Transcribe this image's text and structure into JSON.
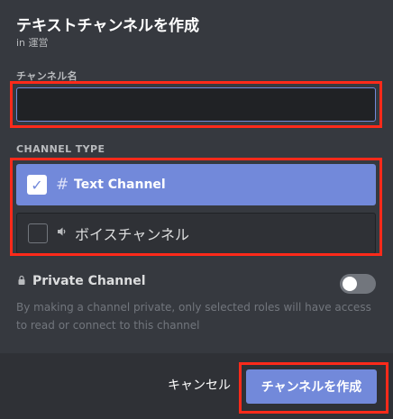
{
  "modal": {
    "title": "テキストチャンネルを作成",
    "subtitle": "in 運営"
  },
  "channel_name": {
    "label": "チャンネル名",
    "value": "",
    "placeholder": ""
  },
  "channel_type": {
    "label": "CHANNEL TYPE",
    "options": [
      {
        "icon": "hash-icon",
        "icon_glyph": "#",
        "label": "Text Channel",
        "selected": true
      },
      {
        "icon": "speaker-icon",
        "icon_glyph": "🔈",
        "label": "ボイスチャンネル",
        "selected": false
      }
    ]
  },
  "private": {
    "label": "Private Channel",
    "description": "By making a channel private, only selected roles will have access to read or connect to this channel",
    "enabled": false
  },
  "footer": {
    "cancel_label": "キャンセル",
    "create_label": "チャンネルを作成"
  },
  "colors": {
    "accent": "#7289da",
    "background": "#36393f",
    "footer": "#2f3136",
    "highlight": "#ff2a1a"
  }
}
